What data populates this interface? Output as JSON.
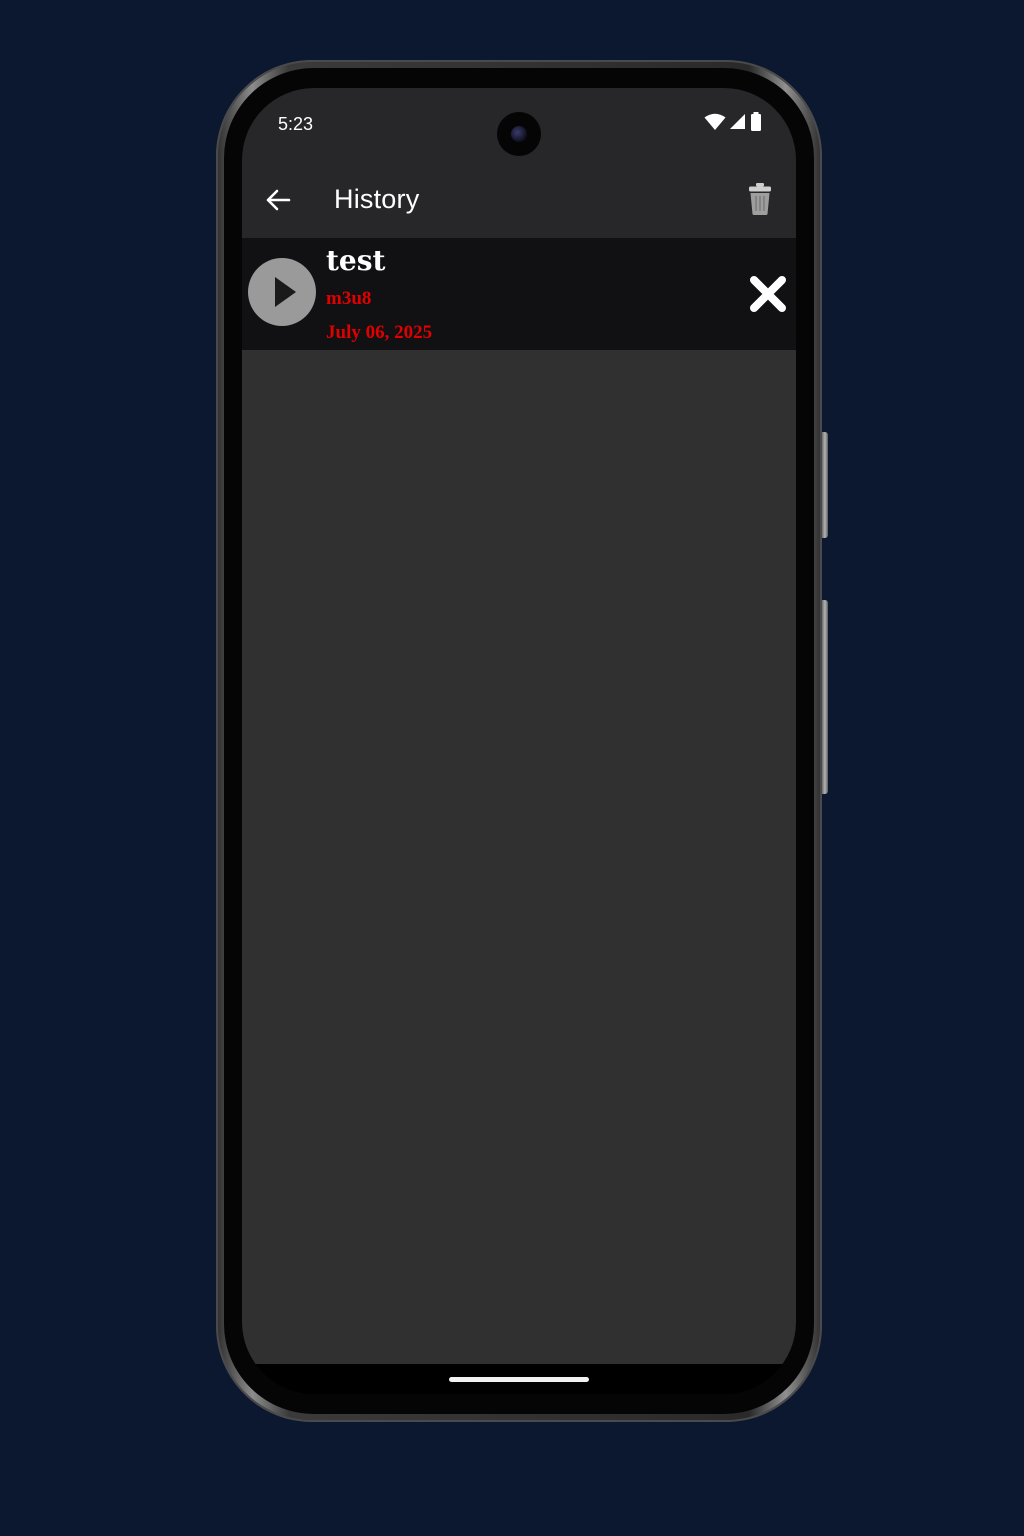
{
  "status_bar": {
    "time": "5:23",
    "icons": [
      "wifi-icon",
      "cellular-signal-icon",
      "battery-icon"
    ]
  },
  "app_bar": {
    "title": "History",
    "back_icon": "arrow-left-icon",
    "clear_icon": "trash-icon"
  },
  "history": {
    "items": [
      {
        "title": "test",
        "type": "m3u8",
        "date": "July 06, 2025",
        "play_icon": "play-icon",
        "remove_icon": "close-icon"
      }
    ]
  },
  "colors": {
    "page_background": "#0b1830",
    "app_bar": "#27272a",
    "content_background": "#303030",
    "item_background": "#111113",
    "accent_red": "#e00000",
    "play_button": "#9a9a9a"
  }
}
